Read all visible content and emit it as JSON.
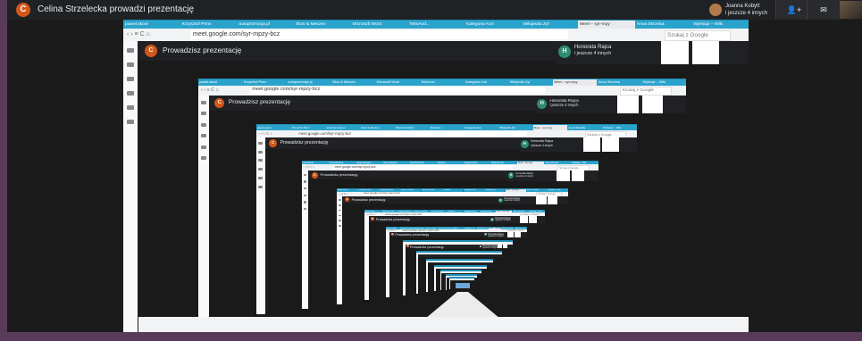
{
  "meeting": {
    "presenter_initial": "C",
    "title": "Celina Strzelecka prowadzi prezentację",
    "participant_name": "Joanna Kobytt",
    "participant_more": "i jeszcze 4 innych",
    "add_person_icon": "person-add-icon",
    "chat_icon": "chat-icon"
  },
  "browser": {
    "tabs": [
      "paweł.skool",
      "Krzysztof Penn",
      "autopromocja.pl",
      "Slow & Meszen",
      "Microsoft Word",
      "TeksAnd...",
      "Kategoria Koń",
      "Wikipedia Zyl",
      "Meet – syr-mpy",
      "Anna Skrzeba",
      "Wyksiąż – Wiki"
    ],
    "active_tab_index": 8,
    "url": "meet.google.com/syr-mpzy-bcz",
    "search_placeholder": "Szukaj z Google"
  },
  "presentation": {
    "initial": "C",
    "label": "Prowadzisz prezentację",
    "host_initial": "H",
    "host_name": "Honorata Rajca",
    "host_more": "i jeszcze 4 innych"
  },
  "colors": {
    "tab_strip": "#1f8fb8",
    "presenter_avatar": "#d2561a",
    "host_avatar": "#2e8b6e",
    "meet_background": "#1b1b1b"
  }
}
